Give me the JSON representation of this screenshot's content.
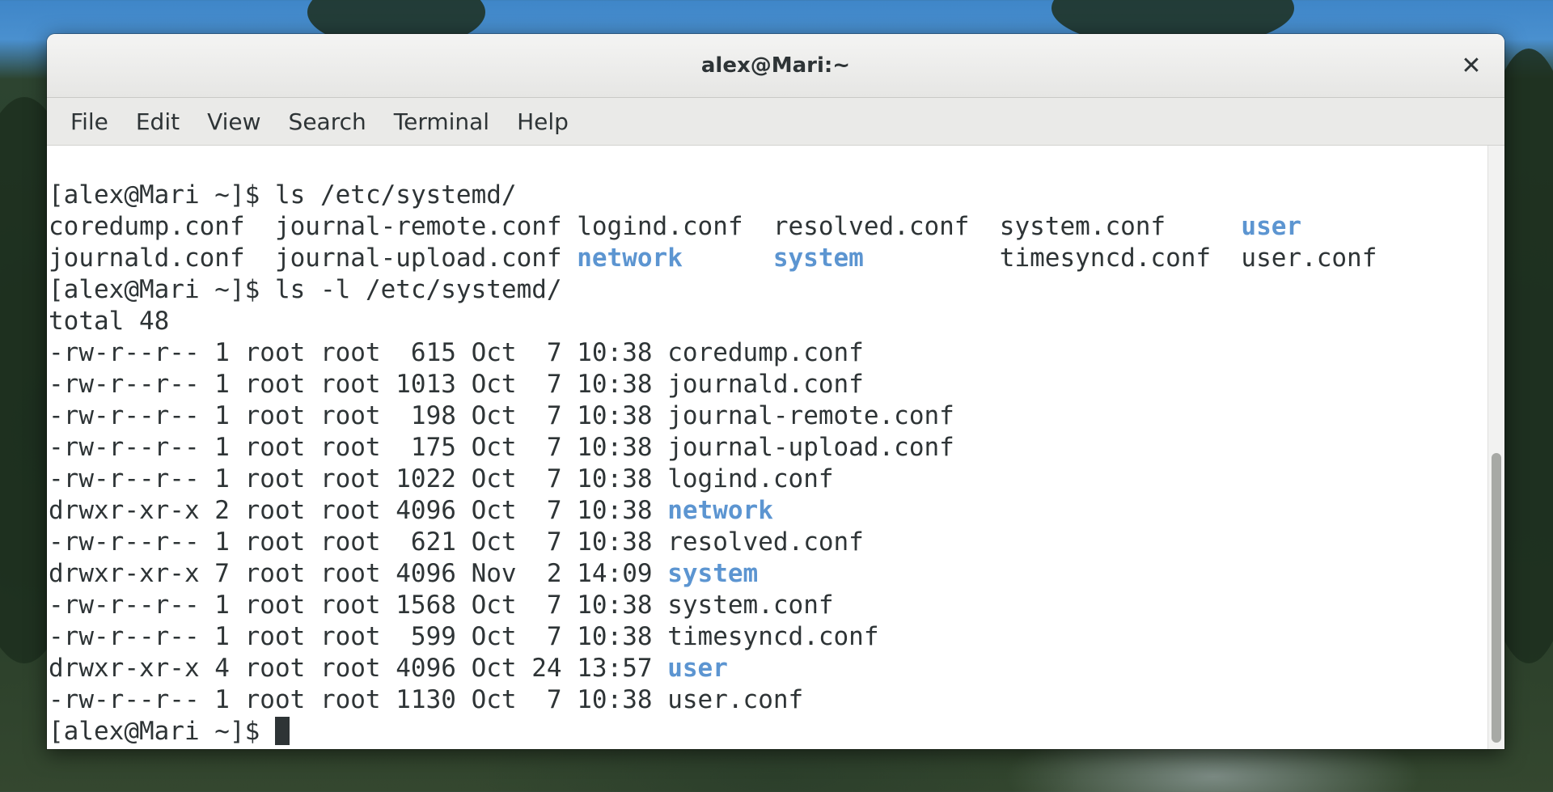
{
  "window": {
    "title": "alex@Mari:~",
    "close_glyph": "✕"
  },
  "menu": [
    "File",
    "Edit",
    "View",
    "Search",
    "Terminal",
    "Help"
  ],
  "terminal": {
    "prompt": "[alex@Mari ~]$",
    "command1": "ls /etc/systemd/",
    "ls_grid": [
      [
        {
          "text": "coredump.conf",
          "dir": false
        },
        {
          "text": "journal-remote.conf",
          "dir": false
        },
        {
          "text": "logind.conf",
          "dir": false
        },
        {
          "text": "resolved.conf",
          "dir": false
        },
        {
          "text": "system.conf",
          "dir": false
        },
        {
          "text": "user",
          "dir": true
        }
      ],
      [
        {
          "text": "journald.conf",
          "dir": false
        },
        {
          "text": "journal-upload.conf",
          "dir": false
        },
        {
          "text": "network",
          "dir": true
        },
        {
          "text": "system",
          "dir": true
        },
        {
          "text": "timesyncd.conf",
          "dir": false
        },
        {
          "text": "user.conf",
          "dir": false
        }
      ]
    ],
    "command2": "ls -l /etc/systemd/",
    "total": "total 48",
    "long_listing": [
      {
        "perms": "-rw-r--r--",
        "links": "1",
        "owner": "root",
        "group": "root",
        "size": "615",
        "month": "Oct",
        "day": "7",
        "time": "10:38",
        "name": "coredump.conf",
        "dir": false
      },
      {
        "perms": "-rw-r--r--",
        "links": "1",
        "owner": "root",
        "group": "root",
        "size": "1013",
        "month": "Oct",
        "day": "7",
        "time": "10:38",
        "name": "journald.conf",
        "dir": false
      },
      {
        "perms": "-rw-r--r--",
        "links": "1",
        "owner": "root",
        "group": "root",
        "size": "198",
        "month": "Oct",
        "day": "7",
        "time": "10:38",
        "name": "journal-remote.conf",
        "dir": false
      },
      {
        "perms": "-rw-r--r--",
        "links": "1",
        "owner": "root",
        "group": "root",
        "size": "175",
        "month": "Oct",
        "day": "7",
        "time": "10:38",
        "name": "journal-upload.conf",
        "dir": false
      },
      {
        "perms": "-rw-r--r--",
        "links": "1",
        "owner": "root",
        "group": "root",
        "size": "1022",
        "month": "Oct",
        "day": "7",
        "time": "10:38",
        "name": "logind.conf",
        "dir": false
      },
      {
        "perms": "drwxr-xr-x",
        "links": "2",
        "owner": "root",
        "group": "root",
        "size": "4096",
        "month": "Oct",
        "day": "7",
        "time": "10:38",
        "name": "network",
        "dir": true
      },
      {
        "perms": "-rw-r--r--",
        "links": "1",
        "owner": "root",
        "group": "root",
        "size": "621",
        "month": "Oct",
        "day": "7",
        "time": "10:38",
        "name": "resolved.conf",
        "dir": false
      },
      {
        "perms": "drwxr-xr-x",
        "links": "7",
        "owner": "root",
        "group": "root",
        "size": "4096",
        "month": "Nov",
        "day": "2",
        "time": "14:09",
        "name": "system",
        "dir": true
      },
      {
        "perms": "-rw-r--r--",
        "links": "1",
        "owner": "root",
        "group": "root",
        "size": "1568",
        "month": "Oct",
        "day": "7",
        "time": "10:38",
        "name": "system.conf",
        "dir": false
      },
      {
        "perms": "-rw-r--r--",
        "links": "1",
        "owner": "root",
        "group": "root",
        "size": "599",
        "month": "Oct",
        "day": "7",
        "time": "10:38",
        "name": "timesyncd.conf",
        "dir": false
      },
      {
        "perms": "drwxr-xr-x",
        "links": "4",
        "owner": "root",
        "group": "root",
        "size": "4096",
        "month": "Oct",
        "day": "24",
        "time": "13:57",
        "name": "user",
        "dir": true
      },
      {
        "perms": "-rw-r--r--",
        "links": "1",
        "owner": "root",
        "group": "root",
        "size": "1130",
        "month": "Oct",
        "day": "7",
        "time": "10:38",
        "name": "user.conf",
        "dir": false
      }
    ]
  },
  "colors": {
    "directory": "#5c95d1",
    "text": "#2e3436",
    "background": "#ffffff"
  },
  "icons": {
    "close": "close-icon",
    "cursor": "block-cursor"
  }
}
